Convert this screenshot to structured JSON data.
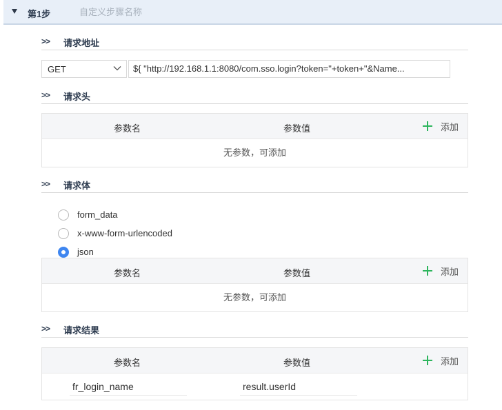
{
  "step": {
    "title": "第1步",
    "name_placeholder": "自定义步骤名称"
  },
  "sections": {
    "request_url": "请求地址",
    "request_headers": "请求头",
    "request_body": "请求体",
    "request_result": "请求结果",
    "arrow": ">>"
  },
  "request": {
    "method": "GET",
    "url": "${ \"http://192.168.1.1:8080/com.sso.login?token=\"+token+\"&Name..."
  },
  "table_labels": {
    "param_name": "参数名",
    "param_value": "参数值",
    "add": "添加",
    "empty": "无参数，可添加"
  },
  "body_types": [
    {
      "label": "form_data",
      "checked": false
    },
    {
      "label": "x-www-form-urlencoded",
      "checked": false
    },
    {
      "label": "json",
      "checked": true
    }
  ],
  "result_params": [
    {
      "name": "fr_login_name",
      "value": "result.userId"
    }
  ],
  "colors": {
    "accent": "#3f86f0",
    "add_green": "#2db55d",
    "header_bg": "#e8eff8"
  }
}
